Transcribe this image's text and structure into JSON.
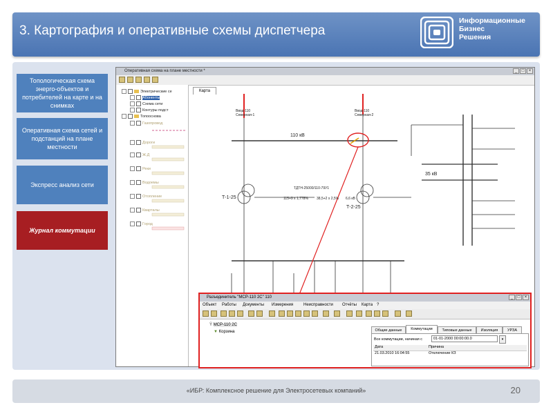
{
  "slide": {
    "title": "3. Картография и оперативные схемы диспетчера",
    "logo": {
      "line1": "Информационные",
      "line2": "Бизнес",
      "line3": "Решения"
    },
    "footer": "«ИБР: Комплексное решение для Электросетевых компаний»",
    "page_number": "20"
  },
  "sidebar": {
    "items": [
      {
        "label": "Топологическая схема энерго-объектов и потребителей на карте и на снимках",
        "active": false
      },
      {
        "label": "Оперативная схема сетей и подстанций на плане местности",
        "active": false
      },
      {
        "label": "Экспресс анализ сети",
        "active": false
      },
      {
        "label": "Журнал коммутации",
        "active": true
      }
    ]
  },
  "app": {
    "title": "Оперативная схема на плане местности *",
    "tab": "Карта",
    "tree": [
      {
        "label": "Электрические се",
        "dim": false,
        "selected": false
      },
      {
        "label": "Абоненты",
        "dim": false,
        "selected": true
      },
      {
        "label": "Схема сети",
        "dim": false,
        "selected": false
      },
      {
        "label": "Контуры подст",
        "dim": false,
        "selected": false
      },
      {
        "label": "Топооснова",
        "dim": false,
        "selected": false
      },
      {
        "label": "Газопровод",
        "dim": true,
        "selected": false
      },
      {
        "label": "Дороги",
        "dim": true,
        "selected": false
      },
      {
        "label": "Ж.Д",
        "dim": true,
        "selected": false
      },
      {
        "label": "Реки",
        "dim": true,
        "selected": false
      },
      {
        "label": "Водоемы",
        "dim": true,
        "selected": false
      },
      {
        "label": "Отопление",
        "dim": true,
        "selected": false
      },
      {
        "label": "Кварталы",
        "dim": true,
        "selected": false
      },
      {
        "label": "Город",
        "dim": true,
        "selected": false
      }
    ]
  },
  "scheme": {
    "input1": "Ввод-110\nСеверная-1",
    "input2": "Ввод-110\nСеверная-2",
    "bus110": "110 кВ",
    "bus35": "35 кВ",
    "t1": "Т-1-25",
    "t2": "Т-2-25",
    "transformer": "ТДТН-25000/110-79У1",
    "params1": "115+9 х 1,778%",
    "params2": "38,5+2 х 2,5%",
    "params3": "6,6 кВ"
  },
  "dialog": {
    "title": "Разъединитель \"МСР-110 2С\" 110",
    "menu": [
      "Объект",
      "Работы",
      "Документы",
      "Измерения",
      "Неисправности",
      "Отчёты",
      "Карта",
      "?"
    ],
    "tree": [
      "МСР-110 2С",
      "Корзина"
    ],
    "tabs": [
      "Общие данные",
      "Коммутации",
      "Типовые данные",
      "Изоляция",
      "УРЗА"
    ],
    "active_tab": 1,
    "filter_label": "Все коммутации, начиная с",
    "filter_value": "01-01-2000 00:00:00.0",
    "columns": [
      "Дата",
      "Причина"
    ],
    "rows": [
      [
        "21.03.2010 16:04:55",
        "Отключение КЗ"
      ]
    ]
  },
  "colors": {
    "header": "#5a82bd",
    "sidebar_btn": "#4f81bd",
    "active_btn": "#a71e22",
    "highlight": "#e02020"
  }
}
